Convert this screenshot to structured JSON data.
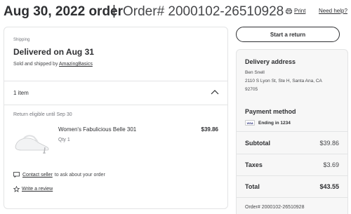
{
  "header": {
    "date_title": "Aug 30, 2022 order",
    "separator": "|",
    "order_number": "Order# 2000102-26510928",
    "print_label": "Print",
    "help_label": "Need help?"
  },
  "shipment": {
    "section_label": "Shipping",
    "status": "Delivered on Aug 31",
    "sold_by_prefix": "Sold and shipped by",
    "seller": "AmazingBasics",
    "items_count": "1 item",
    "return_eligible": "Return eligible until Sep 30",
    "product": {
      "name": "Women's Fabulicious Belle 301",
      "qty": "Qty 1",
      "price": "$39.86"
    },
    "contact_link": "Contact seller",
    "contact_suffix": "to ask about your order",
    "review_link": "Write a review"
  },
  "actions": {
    "return_button": "Start a return"
  },
  "summary": {
    "delivery_heading": "Delivery address",
    "name": "Ben Snell",
    "address_line": "2110 S Lyon St, Ste H, Santa Ana, CA",
    "zip": "92705",
    "payment_heading": "Payment method",
    "card_brand": "VISA",
    "card_ending": "Ending in 1234",
    "subtotal_label": "Subtotal",
    "subtotal_value": "$39.86",
    "taxes_label": "Taxes",
    "taxes_value": "$3.69",
    "total_label": "Total",
    "total_value": "$43.55",
    "order_footer": "Order# 2000102-26510928"
  },
  "icons": {
    "print": "printer-icon",
    "chevron": "chevron-up-icon",
    "contact": "message-icon",
    "review": "star-icon",
    "card": "visa-card-icon"
  },
  "colors": {
    "text": "#2e2f32",
    "muted": "#74767c",
    "border": "#e3e4e5",
    "summary_bg": "#f7f7f7"
  }
}
